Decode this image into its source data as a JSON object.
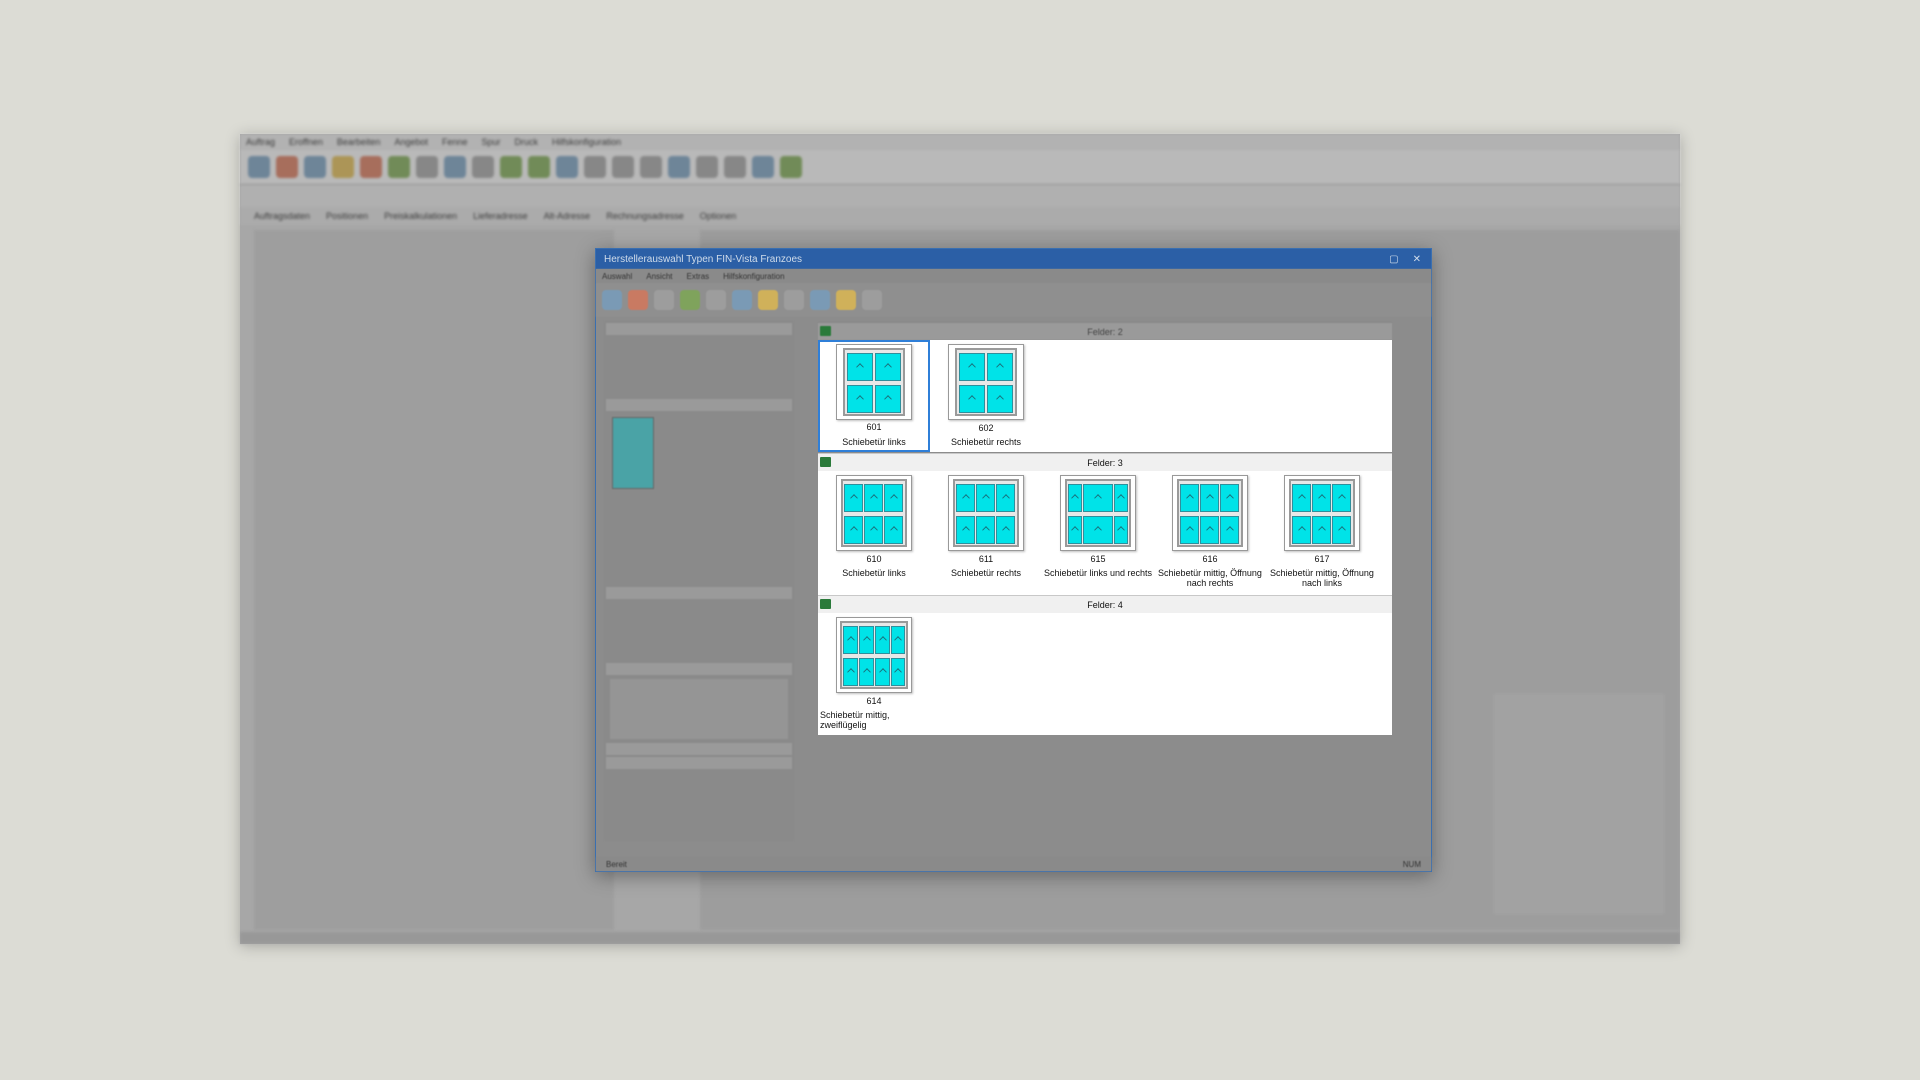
{
  "background_app": {
    "menu": [
      "Auftrag",
      "Eroffnen",
      "Bearbeiten",
      "Angebot",
      "Fenne",
      "Spur",
      "Druck",
      "Hilfskonfiguration"
    ],
    "tabs": [
      "Auftragsdaten",
      "Positionen",
      "Preiskalkulationen",
      "Lieferadresse",
      "Alt-Adresse",
      "Rechnungsadresse",
      "Optionen"
    ]
  },
  "dialog": {
    "title": "Herstellerauswahl Typen FIN-Vista Franzoes",
    "menu": [
      "Auswahl",
      "Ansicht",
      "Extras",
      "Hilfskonfiguration"
    ],
    "status_left": "Bereit",
    "status_right": "NUM",
    "groups": [
      {
        "header": "Felder: 2",
        "items": [
          {
            "number": "601",
            "label": "Schiebetür links",
            "selected": true
          },
          {
            "number": "602",
            "label": "Schiebetür rechts",
            "selected": false
          }
        ]
      },
      {
        "header": "Felder: 3",
        "items": [
          {
            "number": "610",
            "label": "Schiebetür links"
          },
          {
            "number": "611",
            "label": "Schiebetür rechts"
          },
          {
            "number": "615",
            "label": "Schiebetür links und rechts"
          },
          {
            "number": "616",
            "label": "Schiebetür mittig, Öffnung nach rechts"
          },
          {
            "number": "617",
            "label": "Schiebetür mittig, Öffnung nach links"
          }
        ]
      },
      {
        "header": "Felder: 4",
        "items": [
          {
            "number": "614",
            "label": "Schiebetür mittig, zweiflügelig"
          }
        ]
      }
    ]
  },
  "colors": {
    "pane": "#00e3e8",
    "selection": "#2f7fd8",
    "title_bar": "#2b5fa6"
  }
}
